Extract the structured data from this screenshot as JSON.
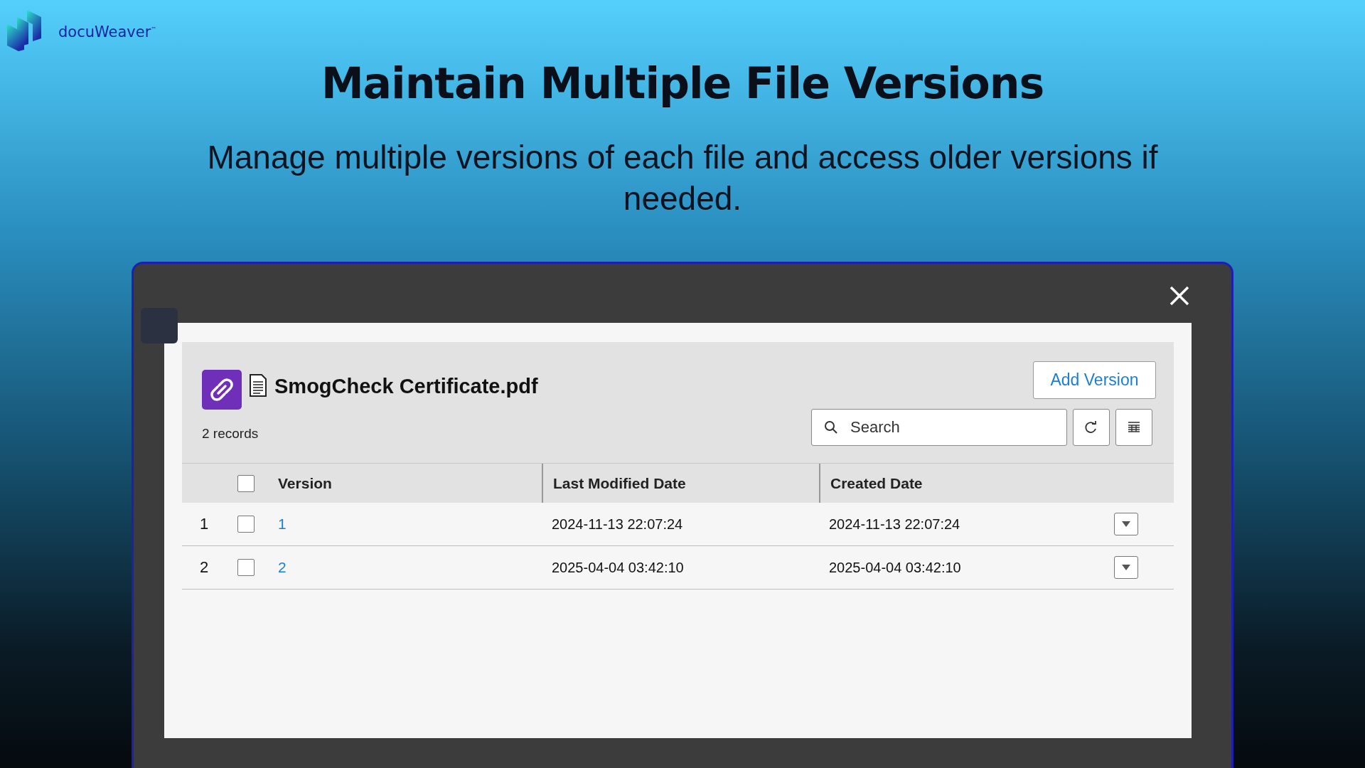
{
  "brand": {
    "name": "docuWeaver",
    "trademark": "™"
  },
  "headline": "Maintain Multiple File Versions",
  "subheadline": "Manage multiple versions of each file and access older versions if needed.",
  "dialog": {
    "file_name": "SmogCheck Certificate.pdf",
    "record_count": "2 records",
    "add_button": "Add Version",
    "search": {
      "placeholder": "Search"
    },
    "select_all_checked": false,
    "columns": [
      "Version",
      "Last Modified Date",
      "Created Date"
    ],
    "rows": [
      {
        "number": "1",
        "checked": false,
        "version": "1",
        "modified": "2024-11-13 22:07:24",
        "created": "2024-11-13 22:07:24"
      },
      {
        "number": "2",
        "checked": false,
        "version": "2",
        "modified": "2025-04-04 03:42:10",
        "created": "2025-04-04 03:42:10"
      }
    ]
  }
}
